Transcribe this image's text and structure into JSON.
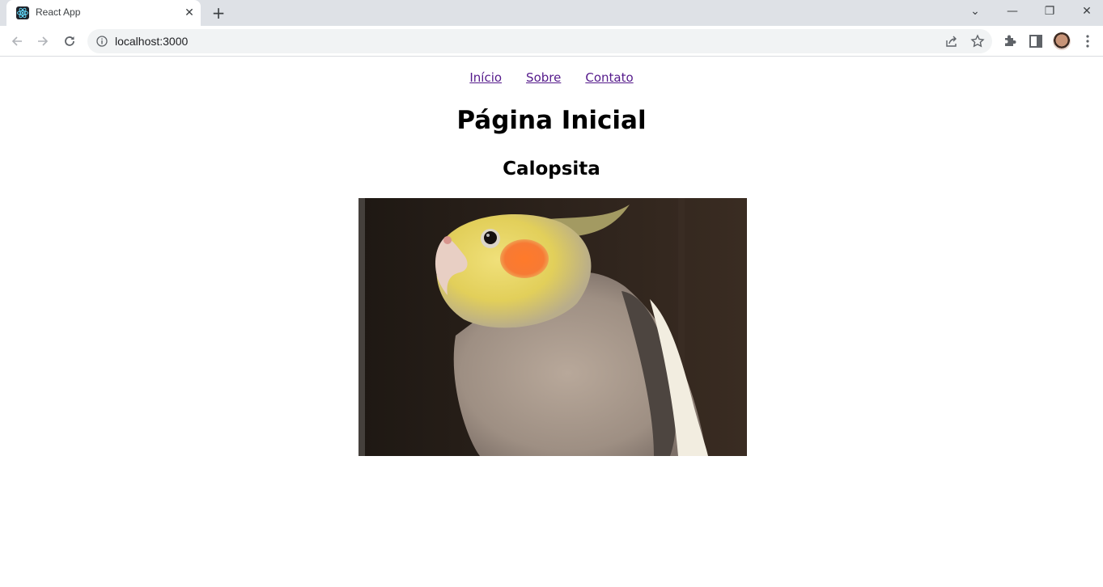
{
  "browser": {
    "tab": {
      "title": "React App",
      "favicon": "react-logo-icon"
    },
    "address": {
      "url": "localhost:3000"
    },
    "icons": {
      "back": "arrow-left-icon",
      "forward": "arrow-right-icon",
      "reload": "reload-icon",
      "site_info": "info-icon",
      "share": "share-icon",
      "bookmark": "star-icon",
      "extensions": "puzzle-icon",
      "side_panel": "side-panel-icon",
      "menu": "kebab-menu-icon"
    },
    "window_controls": {
      "tab_search": "⌄",
      "minimize": "—",
      "restore": "❐",
      "close": "✕"
    }
  },
  "page": {
    "nav": [
      {
        "label": "Início"
      },
      {
        "label": "Sobre"
      },
      {
        "label": "Contato"
      }
    ],
    "title": "Página Inicial",
    "subtitle": "Calopsita",
    "image": {
      "alt": "Calopsita",
      "description": "Photo of a cockatiel with yellow head and orange cheek patch against a dark background"
    }
  },
  "colors": {
    "link_visited": "#551a8b",
    "tabbar_bg": "#dee1e6",
    "omnibox_bg": "#f1f3f4"
  }
}
